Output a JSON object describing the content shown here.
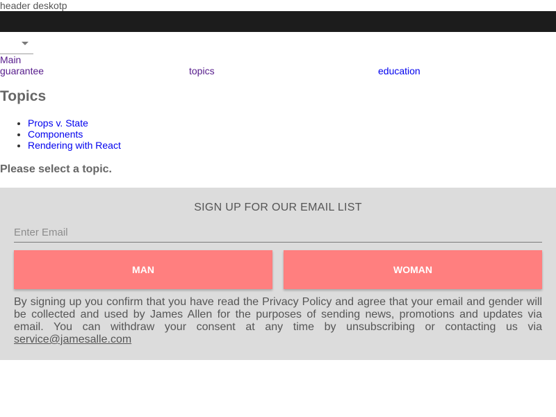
{
  "header": {
    "label": "header deskotp",
    "bar_color": "#1c1c1c"
  },
  "nav": {
    "select_icon": "chevron-down-icon",
    "main_link": "Main",
    "links": [
      "guarantee",
      "topics",
      "education"
    ]
  },
  "topics": {
    "heading": "Topics",
    "items": [
      "Props v. State",
      "Components",
      "Rendering with React"
    ],
    "prompt": "Please select a topic."
  },
  "signup": {
    "title": "SIGN UP FOR OUR EMAIL LIST",
    "email_placeholder": "Enter Email",
    "email_value": "",
    "buttons": {
      "man": "MAN",
      "woman": "WOMAN"
    },
    "legal_text": "By signing up you confirm that you have read the Privacy Policy and agree that your email and gender will be collected and used by James Allen for the purposes of sending news, promotions and updates via email. You can withdraw your consent at any time by unsubscribing or contacting us via",
    "contact_email": "service@jamesalle.com",
    "background_color": "#dcdcdc",
    "button_color": "#ff7f7f"
  }
}
